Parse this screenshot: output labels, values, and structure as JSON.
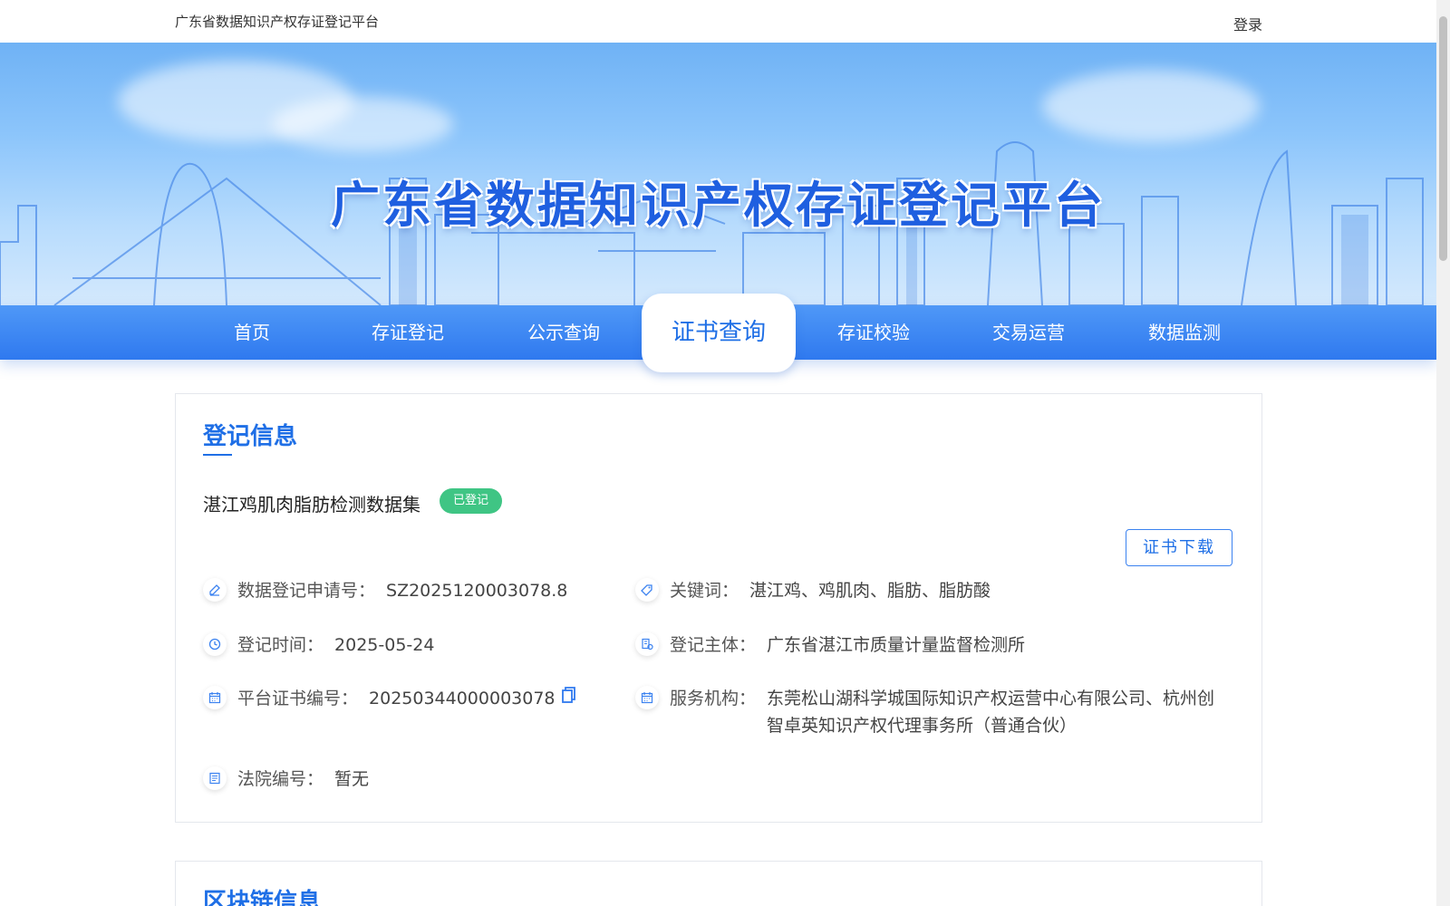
{
  "header": {
    "site_name": "广东省数据知识产权存证登记平台",
    "login_label": "登录"
  },
  "banner": {
    "title": "广东省数据知识产权存证登记平台"
  },
  "nav": {
    "items": [
      {
        "label": "首页"
      },
      {
        "label": "存证登记"
      },
      {
        "label": "公示查询"
      },
      {
        "label": "证书查询"
      },
      {
        "label": "存证校验"
      },
      {
        "label": "交易运营"
      },
      {
        "label": "数据监测"
      }
    ],
    "active": "证书查询"
  },
  "registration": {
    "section_title": "登记信息",
    "dataset_name": "湛江鸡肌肉脂肪检测数据集",
    "status": "已登记",
    "download_label": "证书下载",
    "fields": {
      "application_no": {
        "label": "数据登记申请号：",
        "value": "SZ2025120003078.8",
        "icon": "edit-icon"
      },
      "keywords": {
        "label": "关键词：",
        "value": "湛江鸡、鸡肌肉、脂肪、脂肪酸",
        "icon": "tag-icon"
      },
      "reg_time": {
        "label": "登记时间：",
        "value": "2025-05-24",
        "icon": "clock-icon"
      },
      "reg_subject": {
        "label": "登记主体：",
        "value": "广东省湛江市质量计量监督检测所",
        "icon": "subject-icon"
      },
      "cert_no": {
        "label": "平台证书编号：",
        "value": "20250344000003078",
        "icon": "calendar-icon"
      },
      "service_org": {
        "label": "服务机构：",
        "value": "东莞松山湖科学城国际知识产权运营中心有限公司、杭州创智卓英知识产权代理事务所（普通合伙）",
        "icon": "calendar-icon"
      },
      "court_no": {
        "label": "法院编号：",
        "value": "暂无",
        "icon": "document-icon"
      }
    }
  },
  "blockchain": {
    "section_title": "区块链信息"
  },
  "colors": {
    "primary": "#1f6fe6",
    "nav_bg": "#2f79ef",
    "badge": "#3fc584"
  }
}
